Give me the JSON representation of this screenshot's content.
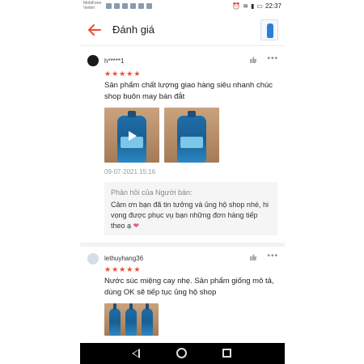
{
  "statusbar": {
    "carrier1": "MobiFone",
    "carrier2": "Viettel",
    "time": "22:37"
  },
  "header": {
    "title": "Đánh giá"
  },
  "reviews": [
    {
      "username": "h*****1",
      "rating": 5,
      "text": "Sản phẩm chất lượng giao hàng siêu nhanh chúc shop buôn may bán đắt",
      "date": "09-07-2021 15:16",
      "reply_label": "Phản hồi của Người bán:",
      "reply_text": "Cảm ơn bạn đã tin tưởng và ủng hộ shop nhé, hi vọng được phục vụ bạn những đơn hàng tiếp theo ạ"
    },
    {
      "username": "lethuyhang36",
      "rating": 5,
      "text": "Nước súc miệng cay nhẹ. Sản phẩm giống mô tả, dùng OK sẽ tiếp tục ủng hộ shop"
    }
  ],
  "icons": {
    "back": "arrow-left-icon",
    "like": "thumbs-up-icon",
    "more": "more-dots-icon",
    "star": "star-icon",
    "heart": "heart-icon"
  },
  "colors": {
    "accent": "#ee4d2d",
    "heart": "#e85a8a"
  }
}
